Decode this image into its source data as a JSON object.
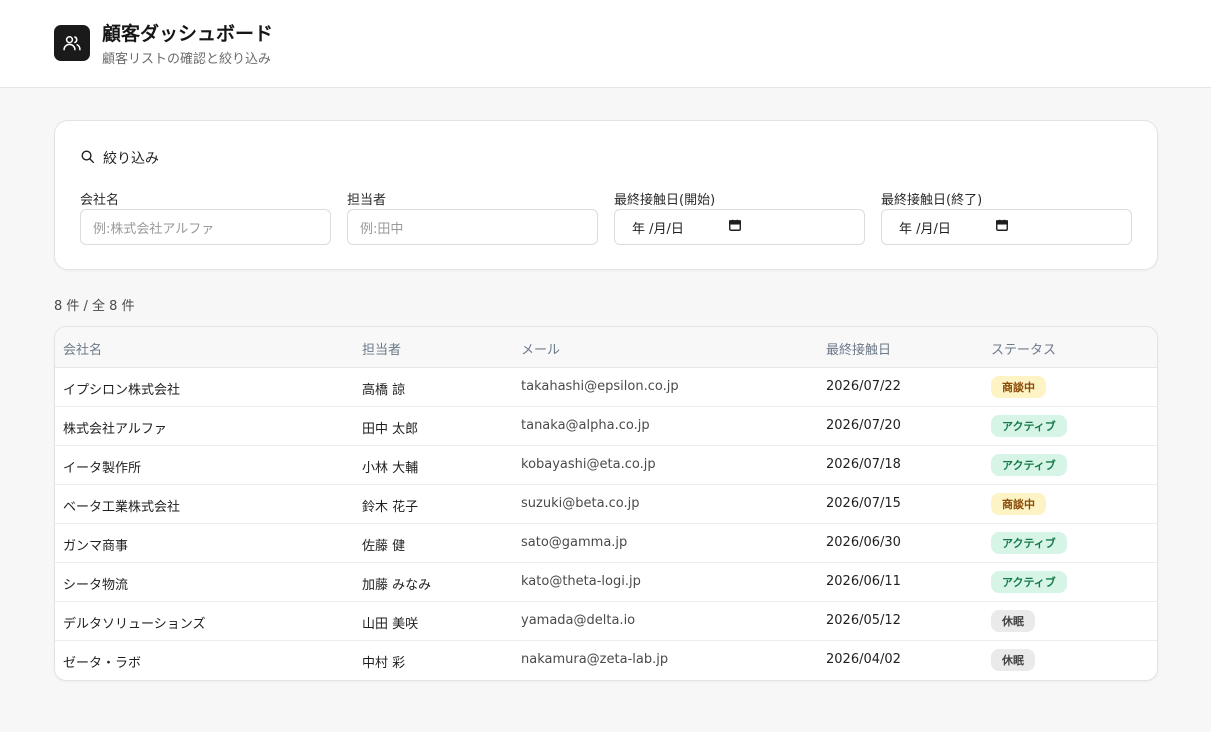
{
  "header": {
    "title": "顧客ダッシュボード",
    "subtitle": "顧客リストの確認と絞り込み",
    "logo_icon": "users-icon"
  },
  "filters": {
    "heading": "絞り込み",
    "heading_icon": "search-icon",
    "company": {
      "label": "会社名",
      "placeholder": "例:株式会社アルファ"
    },
    "rep": {
      "label": "担当者",
      "placeholder": "例:田中"
    },
    "date_from": {
      "label": "最終接触日(開始)",
      "value": "年 /月/日"
    },
    "date_to": {
      "label": "最終接触日(終了)",
      "value": "年 /月/日"
    }
  },
  "summary": {
    "count_text": "8 件 / 全 8 件"
  },
  "table": {
    "columns": [
      "会社名",
      "担当者",
      "メール",
      "最終接触日",
      "ステータス"
    ],
    "rows": [
      {
        "company": "イプシロン株式会社",
        "rep": "高橋 諒",
        "email": "takahashi@epsilon.co.jp",
        "last_contact": "2026/07/22",
        "status": "商談中",
        "status_kind": "deal"
      },
      {
        "company": "株式会社アルファ",
        "rep": "田中 太郎",
        "email": "tanaka@alpha.co.jp",
        "last_contact": "2026/07/20",
        "status": "アクティブ",
        "status_kind": "active"
      },
      {
        "company": "イータ製作所",
        "rep": "小林 大輔",
        "email": "kobayashi@eta.co.jp",
        "last_contact": "2026/07/18",
        "status": "アクティブ",
        "status_kind": "active"
      },
      {
        "company": "ベータ工業株式会社",
        "rep": "鈴木 花子",
        "email": "suzuki@beta.co.jp",
        "last_contact": "2026/07/15",
        "status": "商談中",
        "status_kind": "deal"
      },
      {
        "company": "ガンマ商事",
        "rep": "佐藤 健",
        "email": "sato@gamma.jp",
        "last_contact": "2026/06/30",
        "status": "アクティブ",
        "status_kind": "active"
      },
      {
        "company": "シータ物流",
        "rep": "加藤 みなみ",
        "email": "kato@theta-logi.jp",
        "last_contact": "2026/06/11",
        "status": "アクティブ",
        "status_kind": "active"
      },
      {
        "company": "デルタソリューションズ",
        "rep": "山田 美咲",
        "email": "yamada@delta.io",
        "last_contact": "2026/05/12",
        "status": "休眠",
        "status_kind": "dormant"
      },
      {
        "company": "ゼータ・ラボ",
        "rep": "中村 彩",
        "email": "nakamura@zeta-lab.jp",
        "last_contact": "2026/04/02",
        "status": "休眠",
        "status_kind": "dormant"
      }
    ]
  },
  "colors": {
    "status_deal_bg": "#fdf3c4",
    "status_active_bg": "#d6f5e6",
    "status_dormant_bg": "#eaeaea",
    "header_text": "#6c7a89"
  }
}
